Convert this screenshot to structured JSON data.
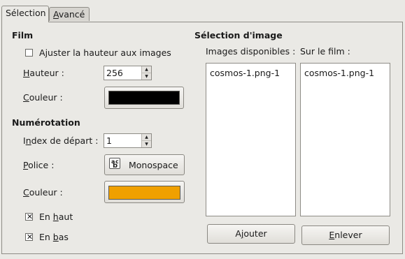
{
  "tabs": [
    {
      "label": "Sélection"
    },
    {
      "label_underlined": "A",
      "label_rest": "vancé"
    }
  ],
  "film": {
    "heading": "Film",
    "fit_height": {
      "label_prefix": "A",
      "label_underlined": "j",
      "label_rest": "uster la hauteur aux images",
      "checked": false
    },
    "height": {
      "label_underlined": "H",
      "label_rest": "auteur :",
      "value": "256"
    },
    "color": {
      "label_underlined": "C",
      "label_rest": "ouleur :",
      "swatch": "#000000"
    }
  },
  "numbering": {
    "heading": "Numérotation",
    "start_index": {
      "label_prefix": "I",
      "label_underlined": "n",
      "label_rest": "dex de départ :",
      "value": "1"
    },
    "font": {
      "label_underlined": "P",
      "label_rest": "olice :",
      "button_label": "Monospace",
      "icon": "font-icon"
    },
    "color": {
      "label_underlined": "C",
      "label_rest": "ouleur :",
      "swatch": "#f0a000"
    },
    "top": {
      "label_prefix": "En ",
      "label_underlined": "h",
      "label_rest": "aut",
      "checked": true
    },
    "bottom": {
      "label_prefix": "En ",
      "label_underlined": "b",
      "label_rest": "as",
      "checked": true
    }
  },
  "image_selection": {
    "heading": "Sélection d'image",
    "available_label": "Images disponibles :",
    "on_film_label": "Sur le film :",
    "available": [
      "cosmos-1.png-1"
    ],
    "on_film": [
      "cosmos-1.png-1"
    ],
    "add_button": {
      "label_prefix": "A",
      "label_underlined": "j",
      "label_rest": "outer"
    },
    "remove_button": {
      "label_underlined": "E",
      "label_rest": "nlever"
    }
  }
}
